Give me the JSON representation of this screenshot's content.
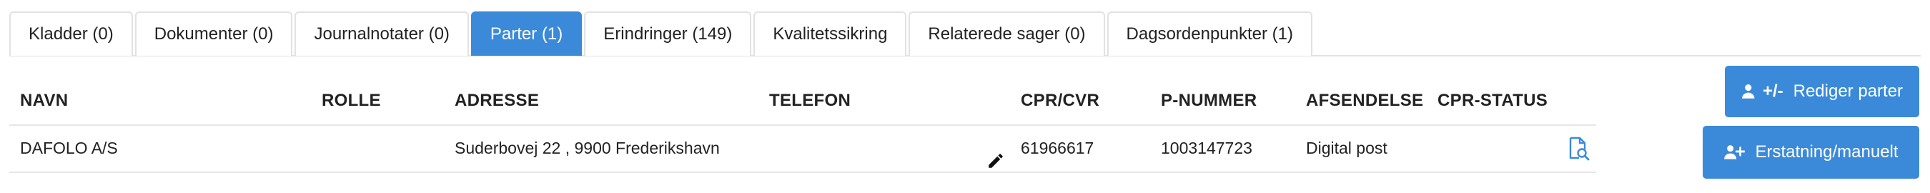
{
  "tabs": [
    {
      "label": "Kladder (0)",
      "active": false
    },
    {
      "label": "Dokumenter (0)",
      "active": false
    },
    {
      "label": "Journalnotater (0)",
      "active": false
    },
    {
      "label": "Parter (1)",
      "active": true
    },
    {
      "label": "Erindringer (149)",
      "active": false
    },
    {
      "label": "Kvalitetssikring",
      "active": false
    },
    {
      "label": "Relaterede sager (0)",
      "active": false
    },
    {
      "label": "Dagsordenpunkter (1)",
      "active": false
    }
  ],
  "table": {
    "headers": [
      "NAVN",
      "ROLLE",
      "ADRESSE",
      "TELEFON",
      "CPR/CVR",
      "P-NUMMER",
      "AFSENDELSE",
      "CPR-STATUS"
    ],
    "rows": [
      {
        "navn": "DAFOLO A/S",
        "rolle": "",
        "adresse": "Suderbovej 22 , 9900 Frederikshavn",
        "telefon": "",
        "cpr_cvr": "61966617",
        "p_nummer": "1003147723",
        "afsendelse": "Digital post",
        "cpr_status": ""
      }
    ]
  },
  "buttons": {
    "edit_prefix": "+/-",
    "edit_label": "Rediger parter",
    "replace_label": "Erstatning/manuelt"
  },
  "icons": {
    "edit_phone": "pencil-icon",
    "cpr_status": "document-search-icon",
    "edit_parties": "user-plus-minus-icon",
    "replace": "user-plus-icon"
  },
  "colors": {
    "accent": "#3b8ad9",
    "border": "#e2e2e2",
    "text": "#222222",
    "white": "#ffffff"
  }
}
